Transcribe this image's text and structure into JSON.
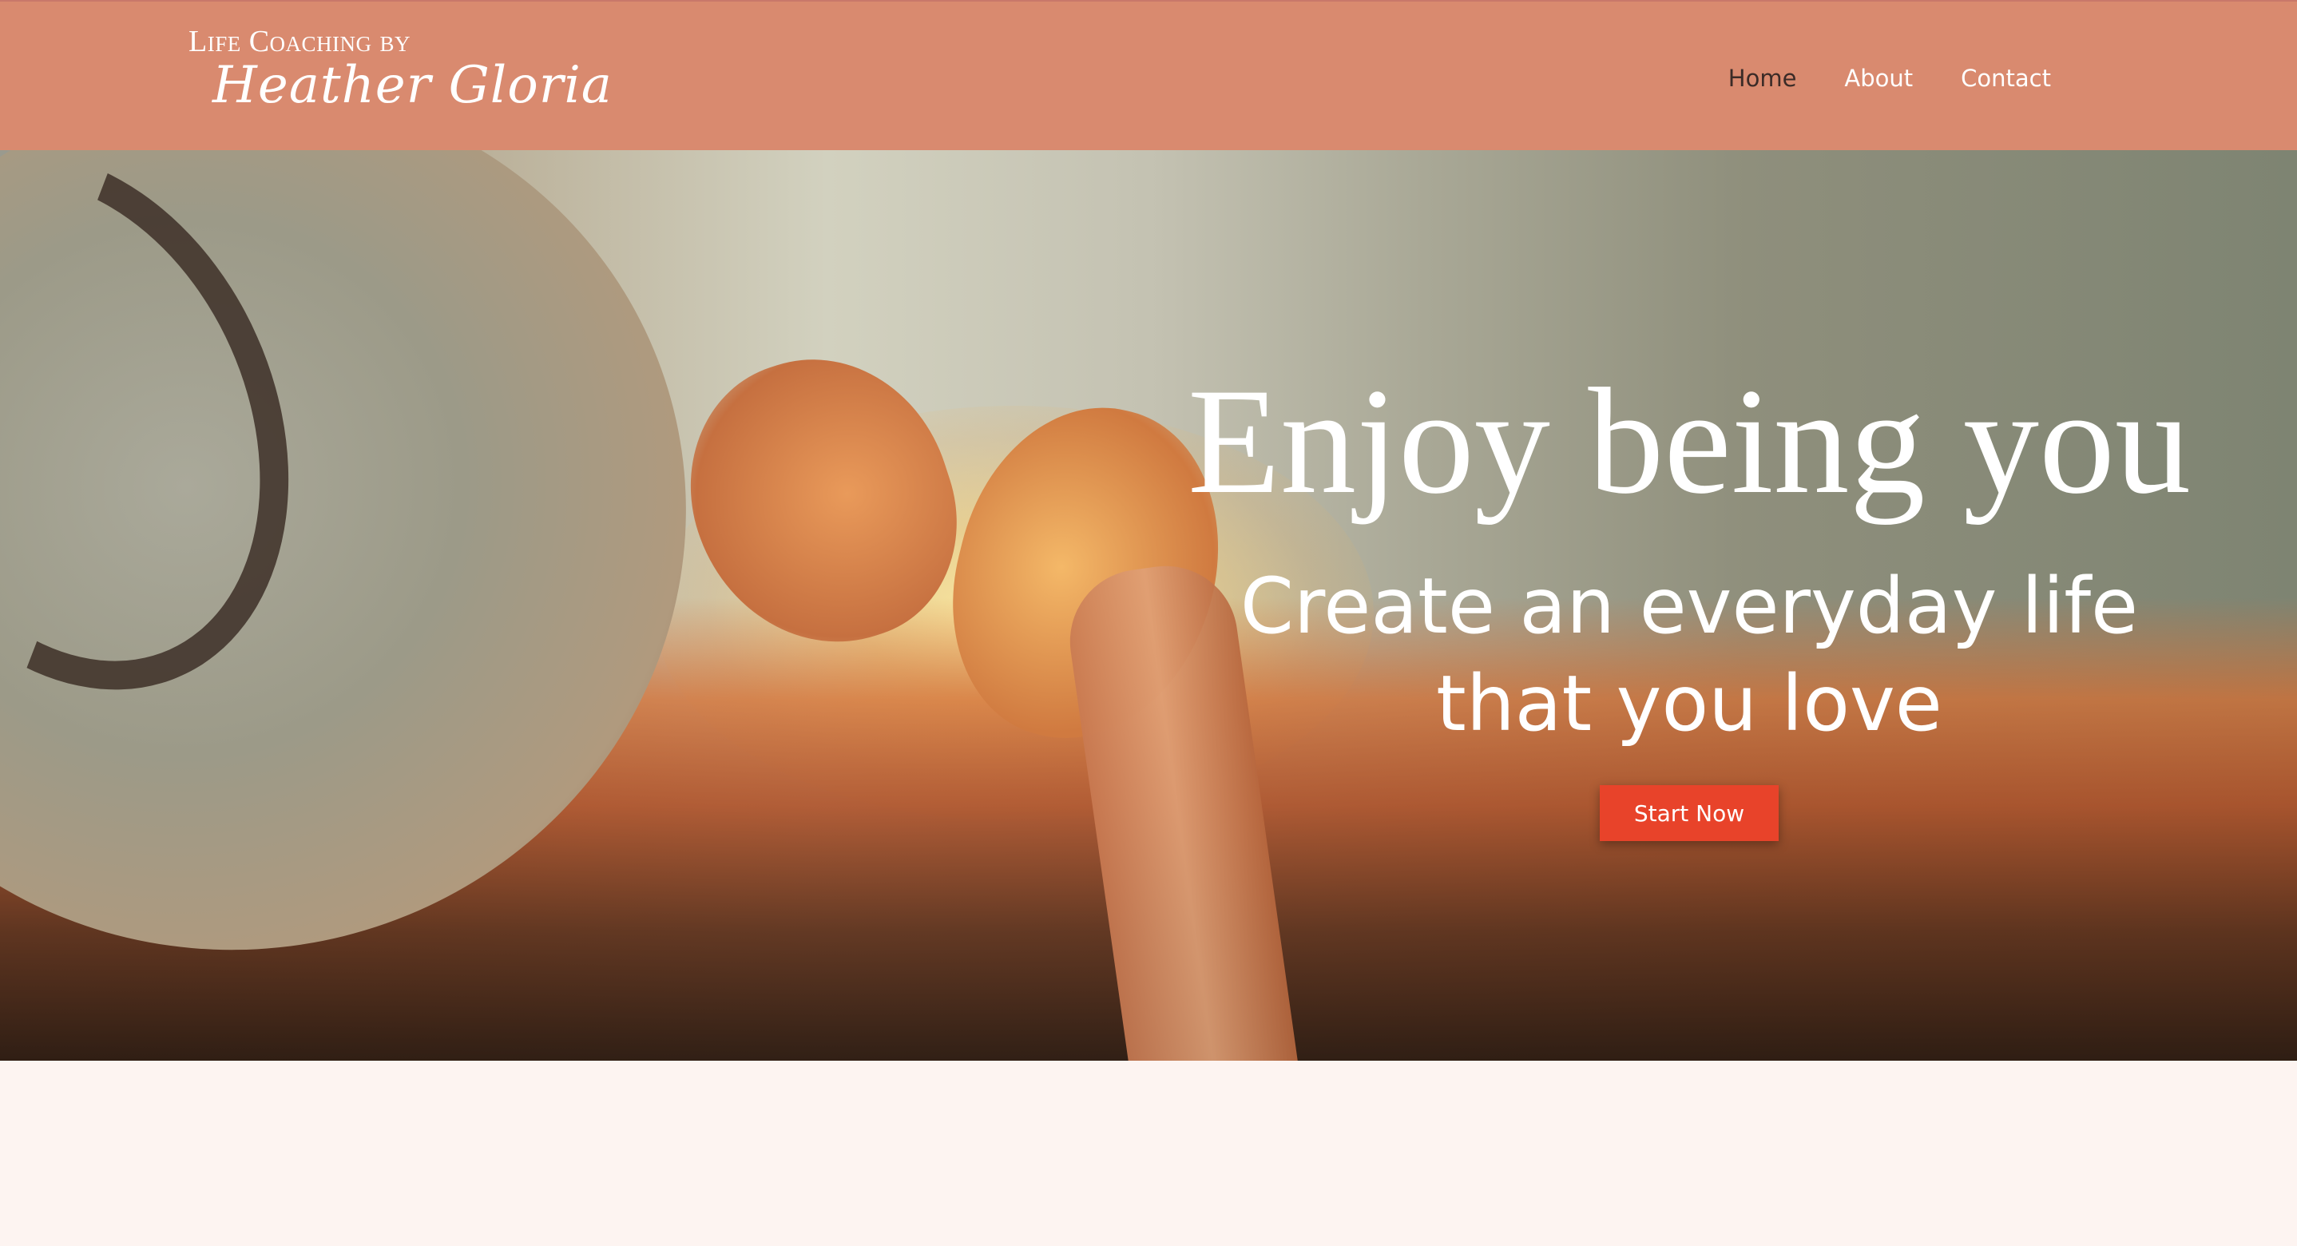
{
  "header": {
    "logo_top": "Life Coaching by",
    "logo_script": "Heather Gloria",
    "nav": [
      {
        "label": "Home",
        "active": true
      },
      {
        "label": "About",
        "active": false
      },
      {
        "label": "Contact",
        "active": false
      }
    ]
  },
  "hero": {
    "title": "Enjoy being you",
    "subtitle": "Create an everyday life that you love",
    "cta_label": "Start Now"
  },
  "colors": {
    "header_bg": "#d98a6f",
    "cta_bg": "#e8432a",
    "page_bg": "#fdf4f1",
    "nav_active": "#3b2b27"
  }
}
